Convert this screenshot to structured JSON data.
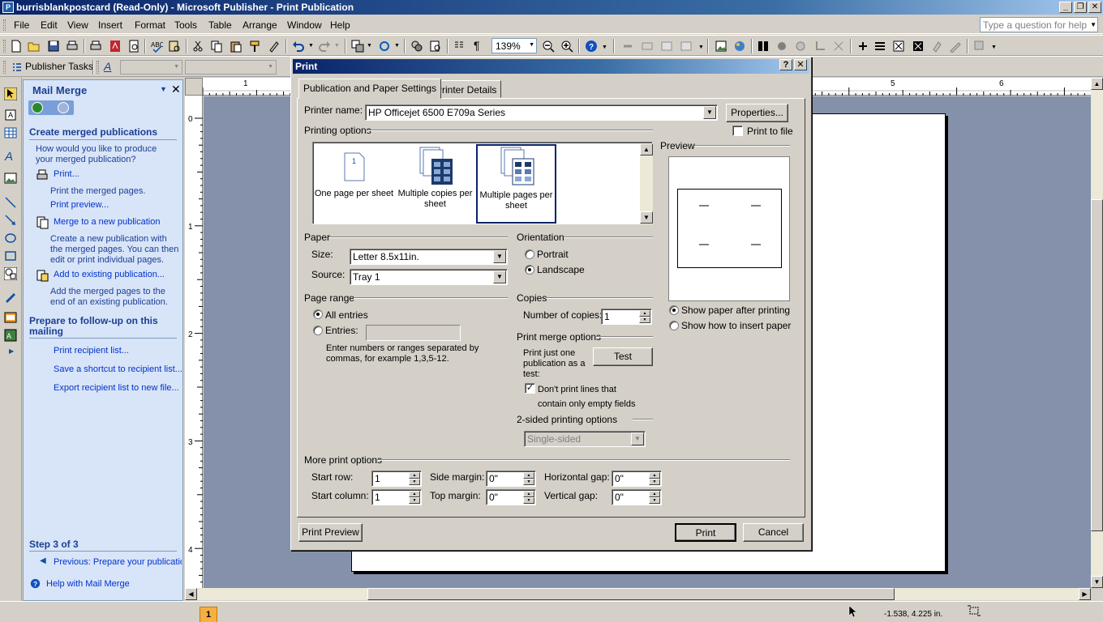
{
  "window": {
    "title": "burrisblankpostcard (Read-Only) - Microsoft Publisher - Print Publication",
    "minimize": "_",
    "restore": "❐",
    "close": "✕"
  },
  "menu": {
    "items": [
      "File",
      "Edit",
      "View",
      "Insert",
      "Format",
      "Tools",
      "Table",
      "Arrange",
      "Window",
      "Help"
    ],
    "help_placeholder": "Type a question for help"
  },
  "toolbar": {
    "zoom": "139%",
    "publisher_tasks": "Publisher Tasks"
  },
  "taskpane": {
    "title": "Mail Merge",
    "section1": "Create merged publications",
    "question": "How would you like to produce your merged publication?",
    "print_link": "Print...",
    "print_desc": "Print the merged pages.",
    "print_preview_link": "Print preview...",
    "merge_new_link": "Merge to a new publication",
    "merge_new_desc": "Create a new publication with the merged pages. You can then edit or print individual pages.",
    "add_existing_link": "Add to existing publication...",
    "add_existing_desc": "Add the merged pages to the end of an existing publication.",
    "section2": "Prepare to follow-up on this mailing",
    "print_recipient": "Print recipient list...",
    "save_shortcut": "Save a shortcut to recipient list...",
    "export_recipient": "Export recipient list to new file...",
    "step": "Step 3 of 3",
    "previous": "Previous: Prepare your publication",
    "help": "Help with Mail Merge"
  },
  "rulers": {
    "top": [
      "1",
      "5",
      "6"
    ],
    "left": [
      "0",
      "1",
      "2",
      "3",
      "4"
    ]
  },
  "status": {
    "page": "1",
    "coords": "-1.538, 4.225 in."
  },
  "dialog": {
    "title": "Print",
    "help_btn": "?",
    "close_btn": "✕",
    "tabs": [
      "Publication and Paper Settings",
      "Printer Details"
    ],
    "printer_name_label": "Printer name:",
    "printer_name": "HP Officejet 6500 E709a Series",
    "properties_btn": "Properties...",
    "print_to_file": "Print to file",
    "printing_options_label": "Printing options",
    "printing_options": [
      {
        "label": "One page per sheet",
        "selected": false
      },
      {
        "label": "Multiple copies per sheet",
        "selected": false
      },
      {
        "label": "Multiple pages per sheet",
        "selected": true
      }
    ],
    "preview_label": "Preview",
    "paper_label": "Paper",
    "size_label": "Size:",
    "size_value": "Letter 8.5x11in.",
    "source_label": "Source:",
    "source_value": "Tray 1",
    "orientation_label": "Orientation",
    "portrait": "Portrait",
    "landscape": "Landscape",
    "orientation_selected": "Landscape",
    "page_range_label": "Page range",
    "all_entries": "All entries",
    "entries": "Entries:",
    "range_hint": "Enter numbers or ranges separated by commas, for example 1,3,5-12.",
    "copies_label": "Copies",
    "num_copies_label": "Number of copies:",
    "num_copies": "1",
    "show_paper": "Show paper after printing",
    "show_insert": "Show how to insert paper",
    "merge_options_label": "Print merge options",
    "print_just_one": "Print just one publication as a test:",
    "test_btn": "Test",
    "dont_print_lines": "Don't print lines that contain only empty fields",
    "two_sided_label": "2-sided printing options",
    "two_sided_value": "Single-sided",
    "more_options_label": "More print options",
    "start_row_label": "Start row:",
    "start_row": "1",
    "start_col_label": "Start column:",
    "start_col": "1",
    "side_margin_label": "Side margin:",
    "side_margin": "0\"",
    "top_margin_label": "Top margin:",
    "top_margin": "0\"",
    "h_gap_label": "Horizontal gap:",
    "h_gap": "0\"",
    "v_gap_label": "Vertical gap:",
    "v_gap": "0\"",
    "print_preview_btn": "Print Preview",
    "print_btn": "Print",
    "cancel_btn": "Cancel"
  }
}
